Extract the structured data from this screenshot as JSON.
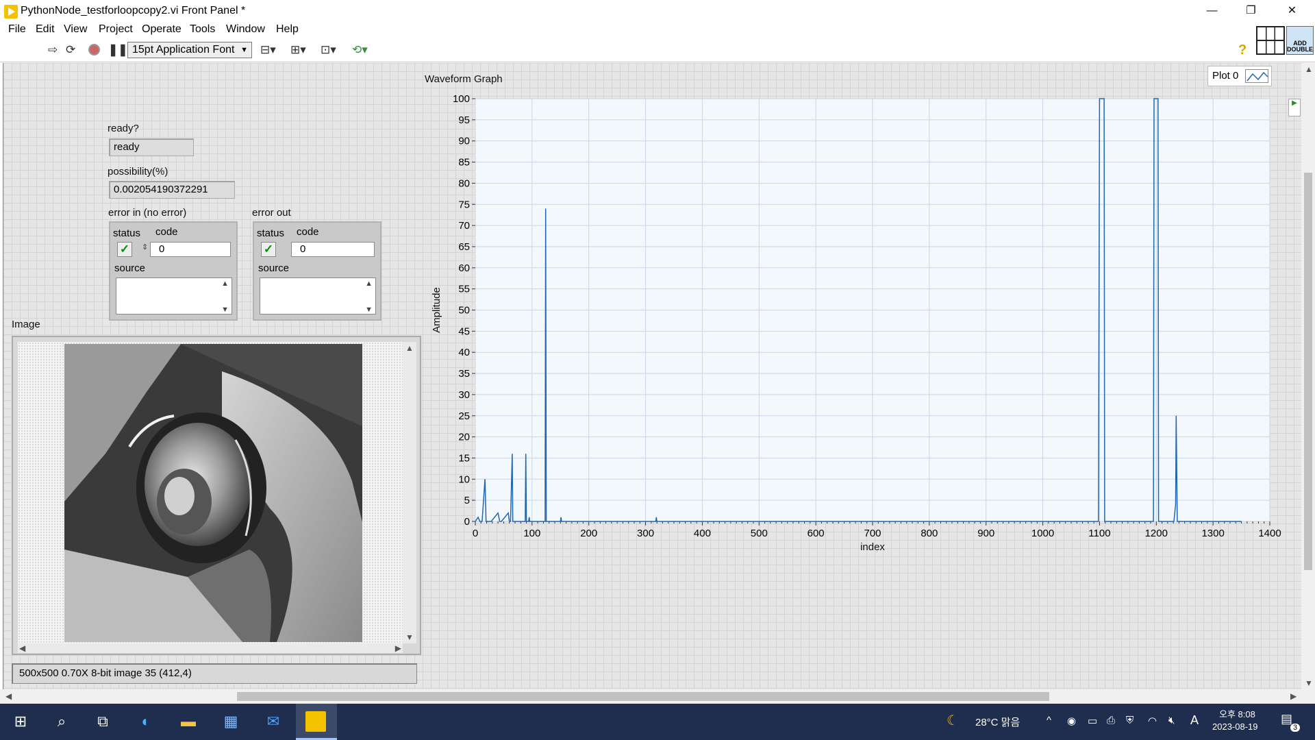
{
  "window": {
    "title": "PythonNode_testforloopcopy2.vi Front Panel *",
    "minimize": "—",
    "restore": "❐",
    "close": "✕"
  },
  "menu": [
    "File",
    "Edit",
    "View",
    "Project",
    "Operate",
    "Tools",
    "Window",
    "Help"
  ],
  "toolbar": {
    "font": "15pt Application Font",
    "help": "?",
    "vi_icon_text": "ADD DOUBLE"
  },
  "controls": {
    "ready_label": "ready?",
    "ready_value": "ready",
    "possibility_label": "possibility(%)",
    "possibility_value": "0.002054190372291",
    "error_in": {
      "title": "error in (no error)",
      "status_label": "status",
      "code_label": "code",
      "code_value": "0",
      "source_label": "source"
    },
    "error_out": {
      "title": "error out",
      "status_label": "status",
      "code_label": "code",
      "code_value": "0",
      "source_label": "source"
    }
  },
  "image": {
    "label": "Image",
    "info": "500x500 0.70X 8-bit image 35     (412,4)"
  },
  "graph": {
    "legend": "Plot 0"
  },
  "chart_data": {
    "type": "line",
    "title": "Waveform Graph",
    "xlabel": "index",
    "ylabel": "Amplitude",
    "xlim": [
      0,
      1400
    ],
    "ylim": [
      0,
      100
    ],
    "xticks": [
      0,
      100,
      200,
      300,
      400,
      500,
      600,
      700,
      800,
      900,
      1000,
      1100,
      1200,
      1300,
      1400
    ],
    "yticks": [
      0,
      5,
      10,
      15,
      20,
      25,
      30,
      35,
      40,
      45,
      50,
      55,
      60,
      65,
      70,
      75,
      80,
      85,
      90,
      95,
      100
    ],
    "grid": true,
    "series": [
      {
        "name": "Plot 0",
        "color": "#2166b0",
        "x": [
          0,
          5,
          8,
          12,
          17,
          19,
          21,
          28,
          40,
          43,
          46,
          58,
          60,
          62,
          65,
          66,
          68,
          80,
          88,
          89,
          90,
          94,
          95,
          96,
          110,
          123,
          124,
          125,
          150,
          151,
          152,
          200,
          318,
          319,
          320,
          500,
          1000,
          1098,
          1100,
          1101,
          1108,
          1109,
          1195,
          1196,
          1203,
          1204,
          1225,
          1231,
          1234,
          1235,
          1237,
          1240,
          1320,
          1350
        ],
        "y": [
          0,
          1,
          0,
          0,
          10,
          0,
          0,
          0,
          2,
          0,
          0,
          2,
          0,
          0,
          16,
          0,
          0,
          0,
          0,
          16,
          0,
          0,
          1,
          0,
          0,
          0,
          74,
          0,
          0,
          1,
          0,
          0,
          0,
          1,
          0,
          0,
          0,
          0,
          100,
          100,
          100,
          0,
          0,
          100,
          100,
          0,
          0,
          0,
          4,
          25,
          0,
          0,
          0,
          0
        ]
      }
    ]
  },
  "taskbar": {
    "weather": "28°C 맑음",
    "ime": "A",
    "time": "오후 8:08",
    "date": "2023-08-19",
    "notifications": "3"
  }
}
